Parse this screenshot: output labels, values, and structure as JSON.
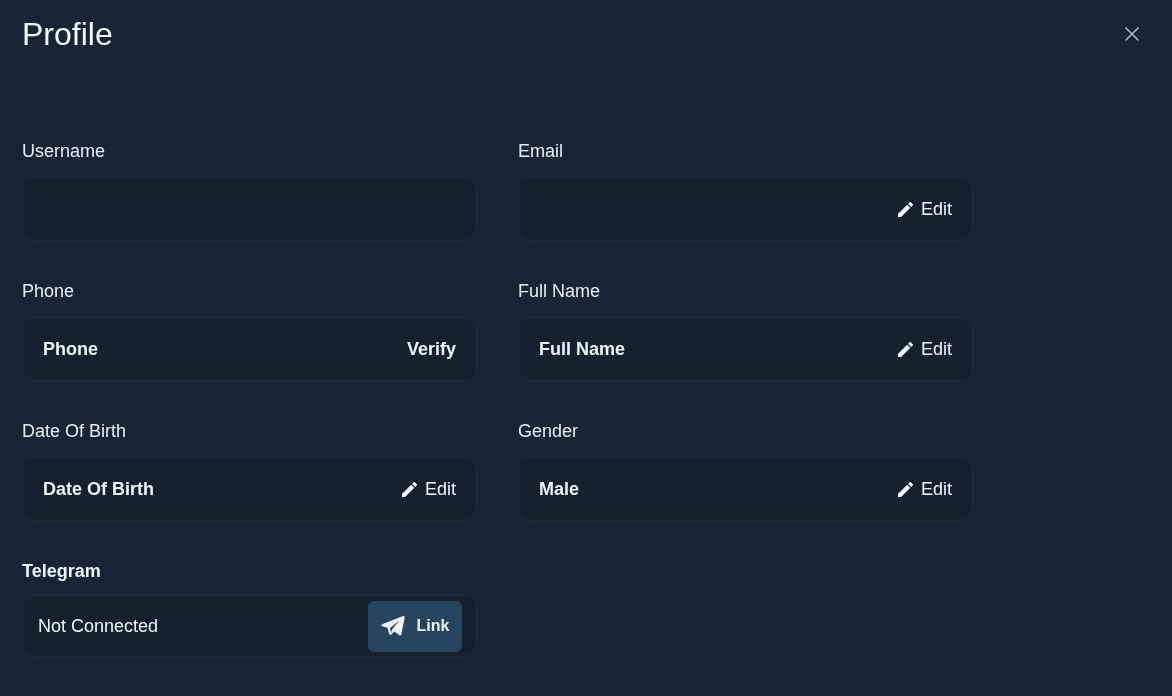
{
  "dialog": {
    "title": "Profile"
  },
  "fields": [
    {
      "label": "Username"
    },
    {
      "label": "Email",
      "action": {
        "kind": "edit",
        "label": "Edit"
      }
    },
    {
      "label": "Phone",
      "placeholder": "Phone",
      "action": {
        "kind": "verify",
        "label": "Verify"
      }
    },
    {
      "label": "Full Name",
      "placeholder": "Full Name",
      "action": {
        "kind": "edit",
        "label": "Edit"
      }
    },
    {
      "label": "Date Of Birth",
      "placeholder": "Date Of Birth",
      "action": {
        "kind": "edit",
        "label": "Edit"
      }
    },
    {
      "label": "Gender",
      "value": "Male",
      "action": {
        "kind": "edit",
        "label": "Edit"
      }
    }
  ],
  "telegram": {
    "label": "Telegram",
    "status": "Not Connected",
    "button": "Link"
  }
}
